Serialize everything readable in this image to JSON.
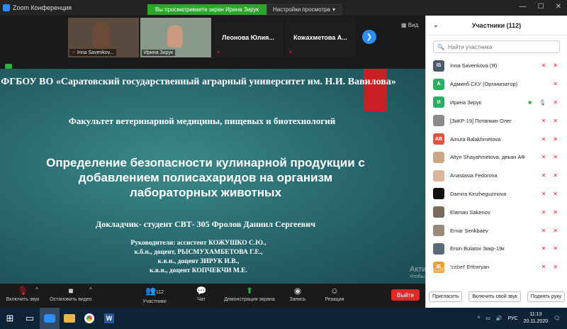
{
  "window": {
    "title": "Zoom Конференция",
    "share_banner": "Вы просматриваете экран Ирина Зирук",
    "view_settings": "Настройки просмотра"
  },
  "strip": {
    "thumbs": [
      {
        "name": "Inna Savenkov..."
      },
      {
        "name": "Ирина Зирук"
      },
      {
        "name": "Леонова Юлия..."
      },
      {
        "name": "Кожахметова А..."
      }
    ],
    "view_label": "Вид"
  },
  "slide": {
    "org": "ФГБОУ ВО «Саратовский государственный аграрный университет им. Н.И. Вавилова»",
    "faculty": "Факультет ветеринарной медицины, пищевых и биотехнологий",
    "title_l1": "Определение безопасности кулинарной продукции с",
    "title_l2": "добавлением полисахаридов на организм",
    "title_l3": "лабораторных животных",
    "speaker": "Докладчик- студент СВТ- 305 Фролов Даниил Сергеевич",
    "sup1": "Руководители: ассистент КОЖУШКО С.Ю.,",
    "sup2": "к.б.н., доцент, РЫСМУХАМБЕТОВА Г.Е.,",
    "sup3": "к.в.н., доцент ЗИРУК И.В.,",
    "sup4": "к.в.н., доцент КОПЧЕКЧИ М.Е."
  },
  "toolbar": {
    "unmute": "Включить звук",
    "stop_video": "Остановить видео",
    "participants": "Участники",
    "participants_count": "112",
    "chat": "Чат",
    "share": "Демонстрация экрана",
    "record": "Запись",
    "reactions": "Реакции",
    "leave": "Выйти"
  },
  "panel": {
    "title": "Участники (112)",
    "search_placeholder": "Найти участника",
    "participants": [
      {
        "initials": "IS",
        "color": "#4b5a6b",
        "name": "Inna Savenkova (Я)"
      },
      {
        "initials": "А",
        "color": "#2bae66",
        "name": "Админб СКУ (Организатор)"
      },
      {
        "initials": "И",
        "color": "#2bae66",
        "name": "Ирина Зирук"
      },
      {
        "initials": "",
        "color": "#8a8a8a",
        "name": "[ЗиКР-19] Потапкин Олег"
      },
      {
        "initials": "AB",
        "color": "#e0533f",
        "name": "Ainura Balakhmetova"
      },
      {
        "initials": "",
        "color": "#c9a889",
        "name": "Altyn Shayahmetova, декан АФ"
      },
      {
        "initials": "",
        "color": "#d8b59c",
        "name": "Anastasia Fedorova"
      },
      {
        "initials": "",
        "color": "#111111",
        "name": "Damira Kinzheguzinova"
      },
      {
        "initials": "",
        "color": "#7a6a5a",
        "name": "Elaman Sakenov"
      },
      {
        "initials": "",
        "color": "#9a8a7a",
        "name": "Ernar Serikbaev"
      },
      {
        "initials": "",
        "color": "#5a6a7a",
        "name": "Ersin Bulatov Зикр-19к"
      },
      {
        "initials": "IE",
        "color": "#f0a030",
        "name": "Izabel' Etibaryan"
      }
    ],
    "invite": "Пригласить",
    "unmute_self": "Включить свой звук",
    "raise_hand": "Поднять руку"
  },
  "watermark": {
    "title": "Активация Windows",
    "subtitle": "Чтобы активировать Windows, перейдите в раздел \"Параметры\"."
  },
  "taskbar": {
    "lang": "РУС",
    "time": "11:13",
    "date": "20.11.2020"
  }
}
